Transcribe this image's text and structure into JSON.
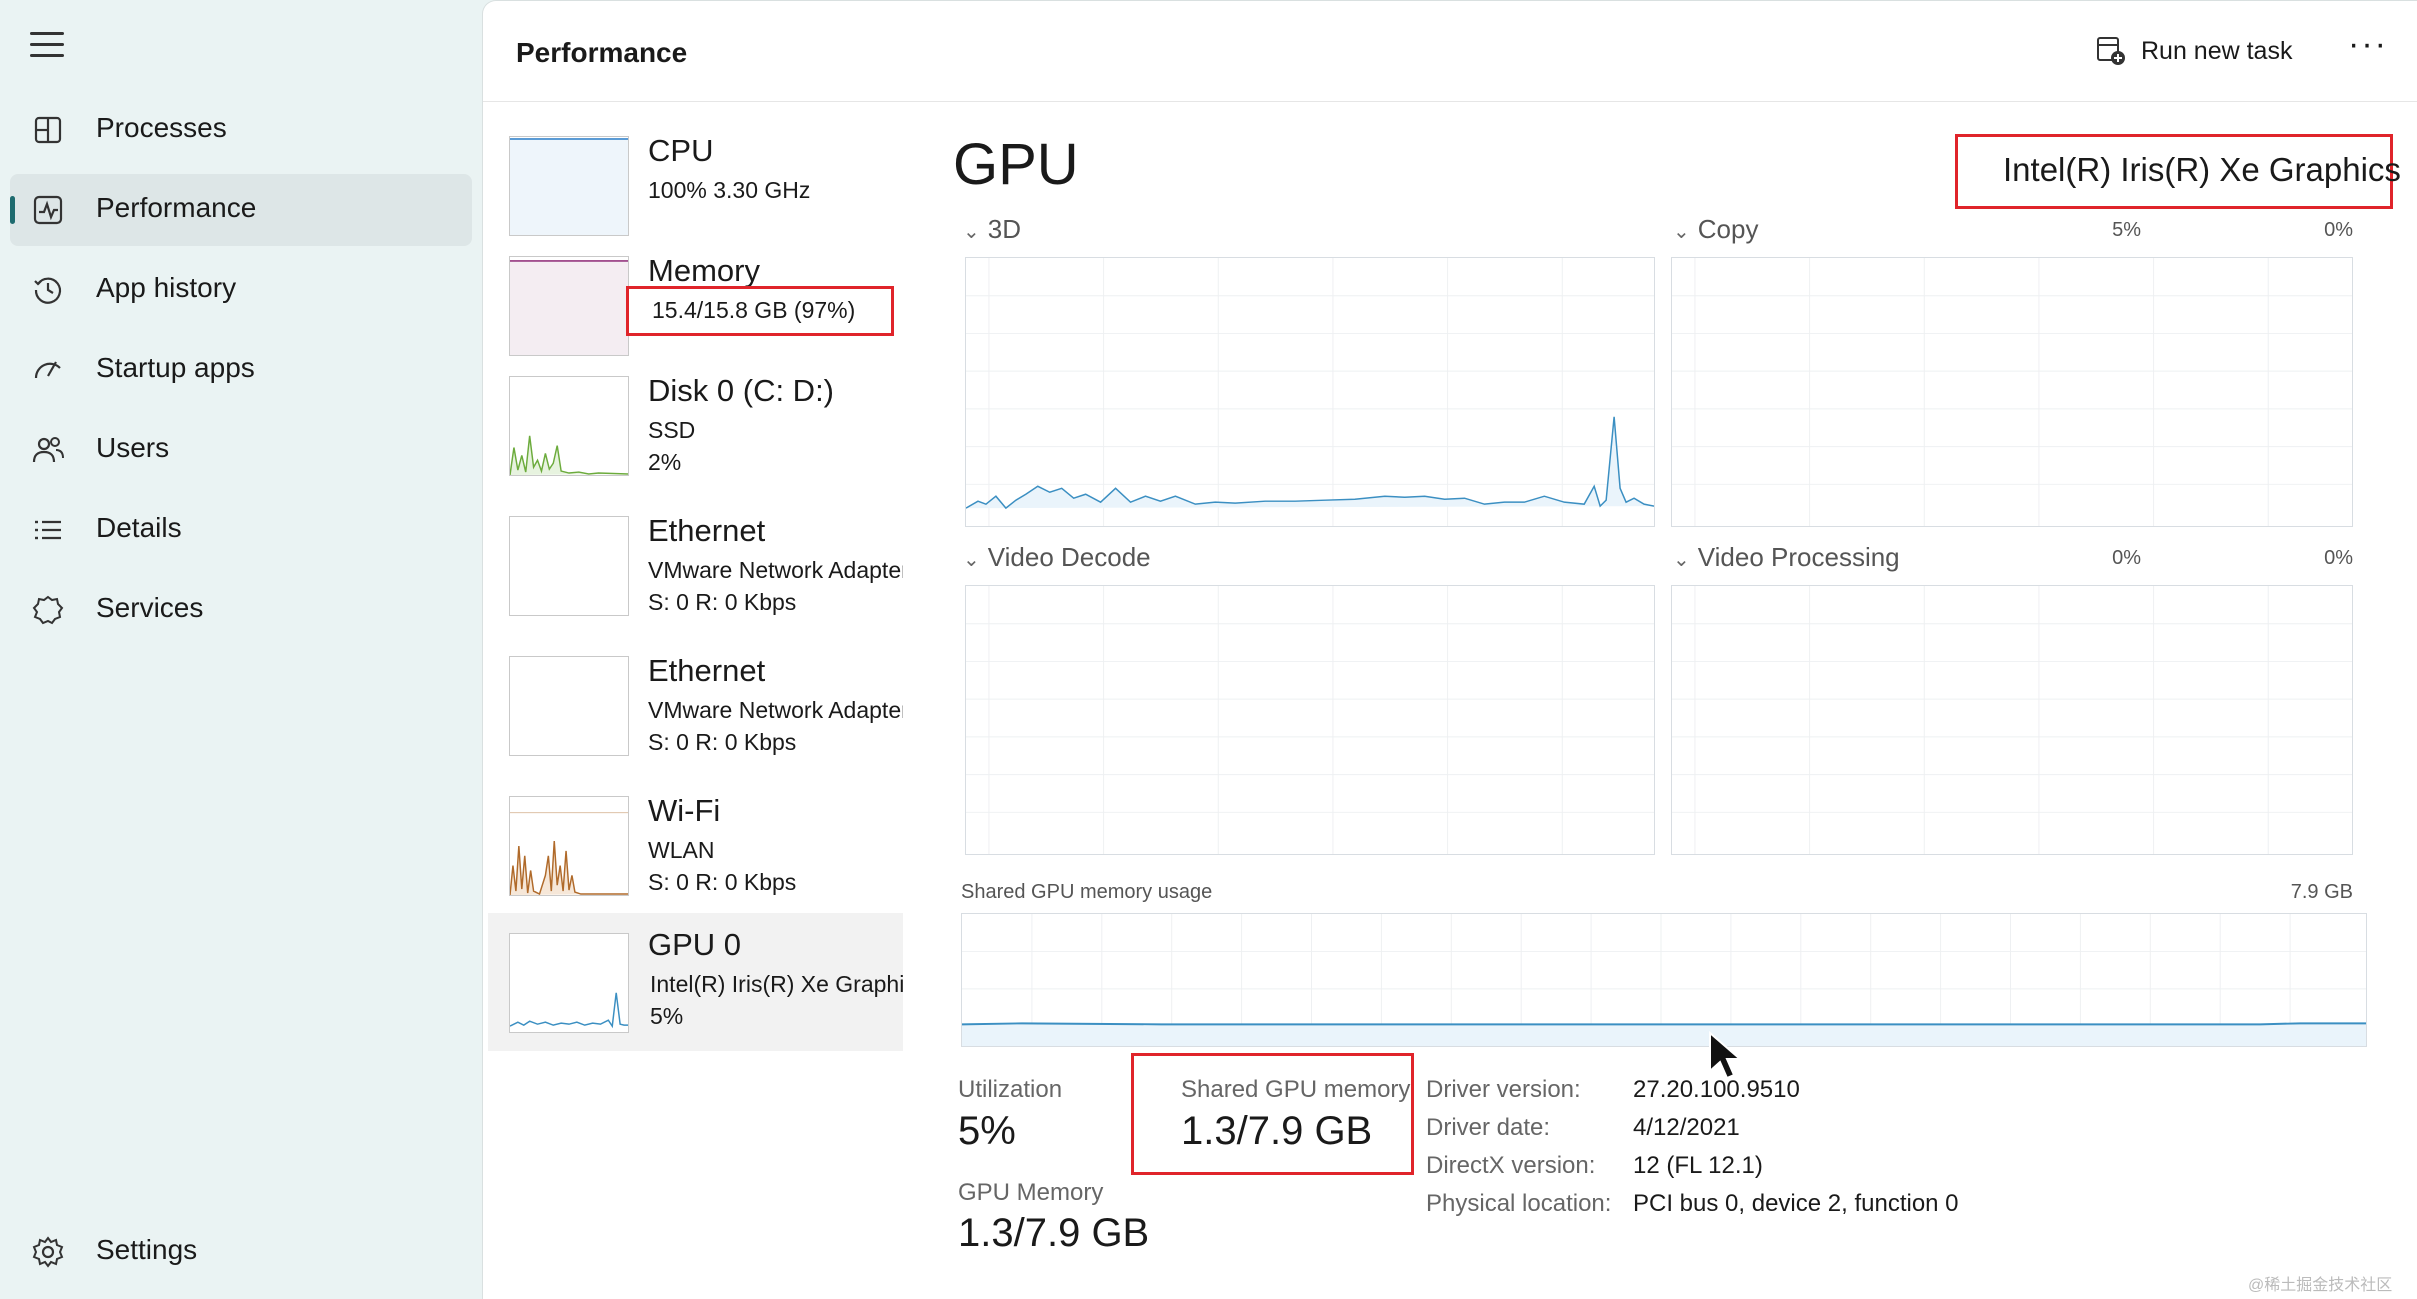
{
  "sidebar": {
    "items": [
      {
        "label": "Processes",
        "icon": "processes-icon"
      },
      {
        "label": "Performance",
        "icon": "performance-icon",
        "active": true
      },
      {
        "label": "App history",
        "icon": "history-icon"
      },
      {
        "label": "Startup apps",
        "icon": "startup-icon"
      },
      {
        "label": "Users",
        "icon": "users-icon"
      },
      {
        "label": "Details",
        "icon": "details-icon"
      },
      {
        "label": "Services",
        "icon": "services-icon"
      }
    ],
    "settings_label": "Settings"
  },
  "header": {
    "title": "Performance",
    "run_task_label": "Run new task",
    "more_label": "···"
  },
  "devices": [
    {
      "name": "CPU",
      "line1": "100%  3.30 GHz",
      "line2": ""
    },
    {
      "name": "Memory",
      "line1": "15.4/15.8 GB (97%)",
      "line2": ""
    },
    {
      "name": "Disk 0 (C: D:)",
      "line1": "SSD",
      "line2": "2%"
    },
    {
      "name": "Ethernet",
      "line1": "VMware Network Adapter",
      "line2": "S: 0  R: 0 Kbps"
    },
    {
      "name": "Ethernet",
      "line1": "VMware Network Adapter",
      "line2": "S: 0  R: 0 Kbps"
    },
    {
      "name": "Wi-Fi",
      "line1": "WLAN",
      "line2": "S: 0  R: 0 Kbps"
    },
    {
      "name": "GPU 0",
      "line1": "Intel(R) Iris(R) Xe Graphics",
      "line2": "5%"
    }
  ],
  "detail": {
    "title": "GPU",
    "model": "Intel(R) Iris(R) Xe Graphics",
    "engines": [
      {
        "label": "3D",
        "pct": "5%"
      },
      {
        "label": "Copy",
        "pct": "0%"
      },
      {
        "label": "Video Decode",
        "pct": "0%"
      },
      {
        "label": "Video Processing",
        "pct": "0%"
      }
    ],
    "shared_mem_usage_label": "Shared GPU memory usage",
    "shared_mem_usage_max": "7.9 GB",
    "stats": {
      "utilization_label": "Utilization",
      "utilization_value": "5%",
      "shared_label": "Shared GPU memory",
      "shared_value": "1.3/7.9 GB",
      "gpu_mem_label": "GPU Memory",
      "gpu_mem_value": "1.3/7.9 GB"
    },
    "props": [
      {
        "key": "Driver version:",
        "value": "27.20.100.9510"
      },
      {
        "key": "Driver date:",
        "value": "4/12/2021"
      },
      {
        "key": "DirectX version:",
        "value": "12 (FL 12.1)"
      },
      {
        "key": "Physical location:",
        "value": "PCI bus 0, device 2, function 0"
      }
    ]
  },
  "watermark": "@稀土掘金技术社区",
  "colors": {
    "cpu": "#5b9bd5",
    "memory": "#a2508f",
    "disk": "#6cab3c",
    "wifi": "#b06a2a",
    "gpu": "#3b8fc2",
    "highlight": "#e0242a"
  }
}
